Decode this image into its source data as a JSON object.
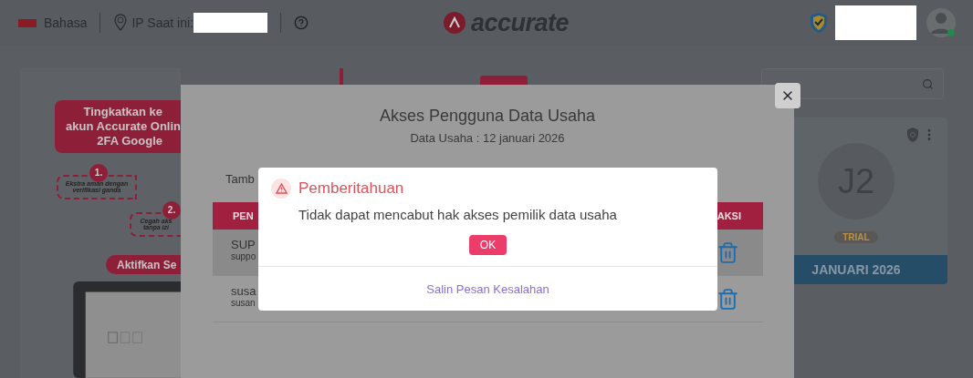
{
  "header": {
    "language": "Bahasa",
    "ip_label": "IP Saat ini:",
    "logo_text": "accurate"
  },
  "promo": {
    "banner_lines": [
      "Tingkatkan ke",
      "akun Accurate Onlin",
      "2FA Google"
    ],
    "steps": [
      {
        "number": "1.",
        "lines": [
          "Ekstra aman dengan",
          "verifikasi ganda"
        ]
      },
      {
        "number": "2.",
        "lines": [
          "Cegah aks",
          "tanpa izi"
        ]
      }
    ],
    "button": "Aktifkan Se"
  },
  "company_card": {
    "initials": "J2",
    "badge": "TRIAL",
    "period": "JANUARI 2026"
  },
  "modal": {
    "title": "Akses Pengguna Data Usaha",
    "subtitle": "Data Usaha : 12 januari 2026",
    "add_text": "Tamb",
    "columns": [
      "PEN",
      "AKSI"
    ],
    "rows": [
      {
        "name": "SUP",
        "email": "suppo",
        "selected": true
      },
      {
        "name": "susa",
        "email": "susan",
        "selected": false
      }
    ]
  },
  "alert": {
    "title": "Pemberitahuan",
    "message": "Tidak dapat mencabut hak akses pemilik data usaha",
    "button": "OK",
    "link": "Salin Pesan Kesalahan"
  }
}
